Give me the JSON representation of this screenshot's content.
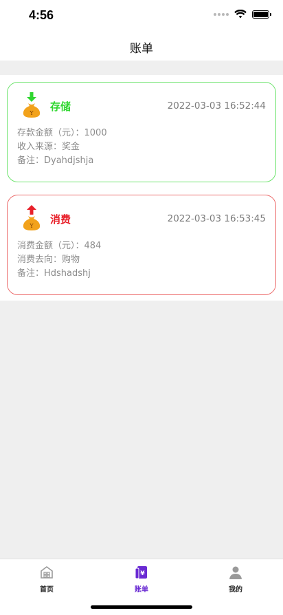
{
  "status": {
    "time": "4:56"
  },
  "nav": {
    "title": "账单"
  },
  "records": [
    {
      "type": "存储",
      "timestamp": "2022-03-03 16:52:44",
      "amount_line": "存款金额（元）：1000",
      "source_line": "收入来源：奖金",
      "note_line": "备注：Dyahdjshja"
    },
    {
      "type": "消费",
      "timestamp": "2022-03-03 16:53:45",
      "amount_line": "消费金额（元）：484",
      "source_line": "消费去向：购物",
      "note_line": "备注：Hdshadshj"
    }
  ],
  "tabs": [
    {
      "label": "首页",
      "icon": "home-icon",
      "active": false
    },
    {
      "label": "账单",
      "icon": "bill-icon",
      "active": true
    },
    {
      "label": "我的",
      "icon": "user-icon",
      "active": false
    }
  ],
  "colors": {
    "deposit": "#2fd62f",
    "expense": "#e8202a",
    "active_tab": "#6a2bd3",
    "bag": "#f2a21b"
  }
}
